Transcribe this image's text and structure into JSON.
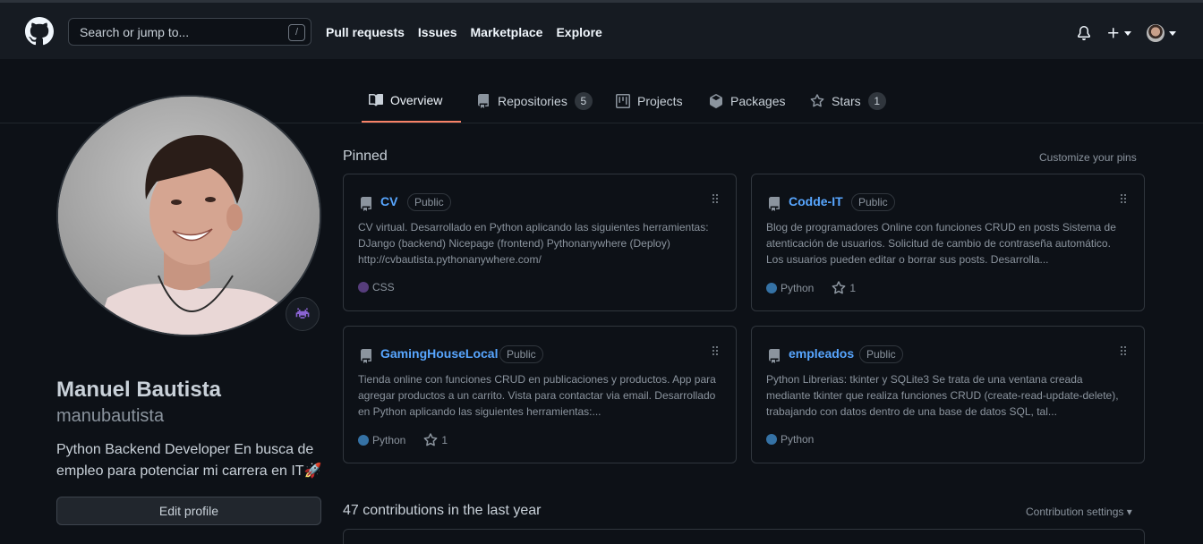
{
  "header": {
    "search_placeholder": "Search or jump to...",
    "slash_key": "/",
    "nav": [
      "Pull requests",
      "Issues",
      "Marketplace",
      "Explore"
    ]
  },
  "tabs": [
    {
      "label": "Overview",
      "count": null
    },
    {
      "label": "Repositories",
      "count": "5"
    },
    {
      "label": "Projects",
      "count": null
    },
    {
      "label": "Packages",
      "count": null
    },
    {
      "label": "Stars",
      "count": "1"
    }
  ],
  "profile": {
    "name": "Manuel Bautista",
    "login": "manubautista",
    "bio": "Python Backend Developer En busca de empleo para potenciar mi carrera en IT🚀",
    "edit_label": "Edit profile"
  },
  "pinned": {
    "heading": "Pinned",
    "customize": "Customize your pins",
    "repos": [
      {
        "name": "CV",
        "visibility": "Public",
        "description": "CV virtual. Desarrollado en Python aplicando las siguientes herramientas: DJango (backend) Nicepage (frontend) Pythonanywhere (Deploy) http://cvbautista.pythonanywhere.com/",
        "language": "CSS",
        "lang_color": "#563d7c",
        "stars": null
      },
      {
        "name": "Codde-IT",
        "visibility": "Public",
        "description": "Blog de programadores Online con funciones CRUD en posts Sistema de atenticación de usuarios. Solicitud de cambio de contraseña automático. Los usuarios pueden editar o borrar sus posts. Desarrolla...",
        "language": "Python",
        "lang_color": "#3572A5",
        "stars": "1"
      },
      {
        "name": "GamingHouseLocal",
        "visibility": "Public",
        "description": "Tienda online con funciones CRUD en publicaciones y productos. App para agregar productos a un carrito. Vista para contactar via email. Desarrollado en Python aplicando las siguientes herramientas:...",
        "language": "Python",
        "lang_color": "#3572A5",
        "stars": "1"
      },
      {
        "name": "empleados",
        "visibility": "Public",
        "description": "Python Librerias: tkinter y SQLite3 Se trata de una ventana creada mediante tkinter que realiza funciones CRUD (create-read-update-delete), trabajando con datos dentro de una base de datos SQL, tal...",
        "language": "Python",
        "lang_color": "#3572A5",
        "stars": null
      }
    ]
  },
  "contributions": {
    "heading": "47 contributions in the last year",
    "settings": "Contribution settings"
  }
}
